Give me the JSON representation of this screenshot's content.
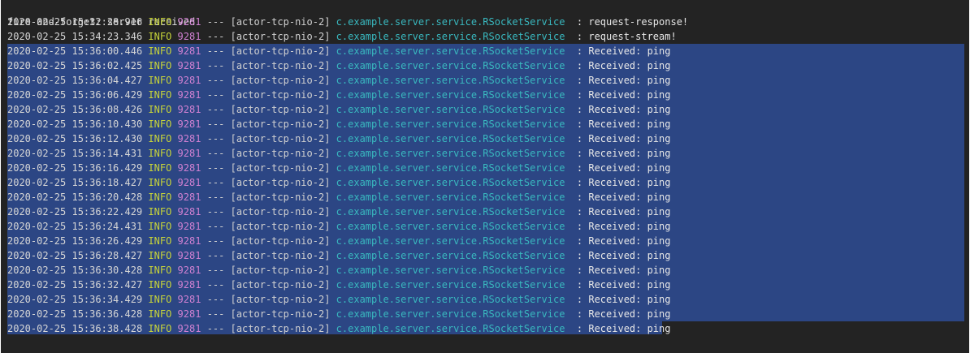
{
  "terminal": {
    "first_line": "fire-and-forget: server received",
    "lines": [
      {
        "ts": "2020-02-25 15:32:28.916",
        "level": "INFO",
        "pid": "9281",
        "sep": "---",
        "thread": "[actor-tcp-nio-2]",
        "logger": "c.example.server.service.RSocketService",
        "msg": ": request-response!"
      },
      {
        "ts": "2020-02-25 15:34:23.346",
        "level": "INFO",
        "pid": "9281",
        "sep": "---",
        "thread": "[actor-tcp-nio-2]",
        "logger": "c.example.server.service.RSocketService",
        "msg": ": request-stream!"
      },
      {
        "ts": "2020-02-25 15:36:00.446",
        "level": "INFO",
        "pid": "9281",
        "sep": "---",
        "thread": "[actor-tcp-nio-2]",
        "logger": "c.example.server.service.RSocketService",
        "msg": ": Received: ping"
      },
      {
        "ts": "2020-02-25 15:36:02.425",
        "level": "INFO",
        "pid": "9281",
        "sep": "---",
        "thread": "[actor-tcp-nio-2]",
        "logger": "c.example.server.service.RSocketService",
        "msg": ": Received: ping"
      },
      {
        "ts": "2020-02-25 15:36:04.427",
        "level": "INFO",
        "pid": "9281",
        "sep": "---",
        "thread": "[actor-tcp-nio-2]",
        "logger": "c.example.server.service.RSocketService",
        "msg": ": Received: ping"
      },
      {
        "ts": "2020-02-25 15:36:06.429",
        "level": "INFO",
        "pid": "9281",
        "sep": "---",
        "thread": "[actor-tcp-nio-2]",
        "logger": "c.example.server.service.RSocketService",
        "msg": ": Received: ping"
      },
      {
        "ts": "2020-02-25 15:36:08.426",
        "level": "INFO",
        "pid": "9281",
        "sep": "---",
        "thread": "[actor-tcp-nio-2]",
        "logger": "c.example.server.service.RSocketService",
        "msg": ": Received: ping"
      },
      {
        "ts": "2020-02-25 15:36:10.430",
        "level": "INFO",
        "pid": "9281",
        "sep": "---",
        "thread": "[actor-tcp-nio-2]",
        "logger": "c.example.server.service.RSocketService",
        "msg": ": Received: ping"
      },
      {
        "ts": "2020-02-25 15:36:12.430",
        "level": "INFO",
        "pid": "9281",
        "sep": "---",
        "thread": "[actor-tcp-nio-2]",
        "logger": "c.example.server.service.RSocketService",
        "msg": ": Received: ping"
      },
      {
        "ts": "2020-02-25 15:36:14.431",
        "level": "INFO",
        "pid": "9281",
        "sep": "---",
        "thread": "[actor-tcp-nio-2]",
        "logger": "c.example.server.service.RSocketService",
        "msg": ": Received: ping"
      },
      {
        "ts": "2020-02-25 15:36:16.429",
        "level": "INFO",
        "pid": "9281",
        "sep": "---",
        "thread": "[actor-tcp-nio-2]",
        "logger": "c.example.server.service.RSocketService",
        "msg": ": Received: ping"
      },
      {
        "ts": "2020-02-25 15:36:18.427",
        "level": "INFO",
        "pid": "9281",
        "sep": "---",
        "thread": "[actor-tcp-nio-2]",
        "logger": "c.example.server.service.RSocketService",
        "msg": ": Received: ping"
      },
      {
        "ts": "2020-02-25 15:36:20.428",
        "level": "INFO",
        "pid": "9281",
        "sep": "---",
        "thread": "[actor-tcp-nio-2]",
        "logger": "c.example.server.service.RSocketService",
        "msg": ": Received: ping"
      },
      {
        "ts": "2020-02-25 15:36:22.429",
        "level": "INFO",
        "pid": "9281",
        "sep": "---",
        "thread": "[actor-tcp-nio-2]",
        "logger": "c.example.server.service.RSocketService",
        "msg": ": Received: ping"
      },
      {
        "ts": "2020-02-25 15:36:24.431",
        "level": "INFO",
        "pid": "9281",
        "sep": "---",
        "thread": "[actor-tcp-nio-2]",
        "logger": "c.example.server.service.RSocketService",
        "msg": ": Received: ping"
      },
      {
        "ts": "2020-02-25 15:36:26.429",
        "level": "INFO",
        "pid": "9281",
        "sep": "---",
        "thread": "[actor-tcp-nio-2]",
        "logger": "c.example.server.service.RSocketService",
        "msg": ": Received: ping"
      },
      {
        "ts": "2020-02-25 15:36:28.427",
        "level": "INFO",
        "pid": "9281",
        "sep": "---",
        "thread": "[actor-tcp-nio-2]",
        "logger": "c.example.server.service.RSocketService",
        "msg": ": Received: ping"
      },
      {
        "ts": "2020-02-25 15:36:30.428",
        "level": "INFO",
        "pid": "9281",
        "sep": "---",
        "thread": "[actor-tcp-nio-2]",
        "logger": "c.example.server.service.RSocketService",
        "msg": ": Received: ping"
      },
      {
        "ts": "2020-02-25 15:36:32.427",
        "level": "INFO",
        "pid": "9281",
        "sep": "---",
        "thread": "[actor-tcp-nio-2]",
        "logger": "c.example.server.service.RSocketService",
        "msg": ": Received: ping"
      },
      {
        "ts": "2020-02-25 15:36:34.429",
        "level": "INFO",
        "pid": "9281",
        "sep": "---",
        "thread": "[actor-tcp-nio-2]",
        "logger": "c.example.server.service.RSocketService",
        "msg": ": Received: ping"
      },
      {
        "ts": "2020-02-25 15:36:36.428",
        "level": "INFO",
        "pid": "9281",
        "sep": "---",
        "thread": "[actor-tcp-nio-2]",
        "logger": "c.example.server.service.RSocketService",
        "msg": ": Received: ping"
      },
      {
        "ts": "2020-02-25 15:36:38.428",
        "level": "INFO",
        "pid": "9281",
        "sep": "---",
        "thread": "[actor-tcp-nio-2]",
        "logger": "c.example.server.service.RSocketService",
        "msg": ": Received: ping"
      }
    ]
  },
  "colors": {
    "background": "#232323",
    "selection": "#2c4684",
    "level": "#c7d43a",
    "pid": "#d081d2",
    "logger": "#39b8bf",
    "text": "#d8d8d8"
  }
}
